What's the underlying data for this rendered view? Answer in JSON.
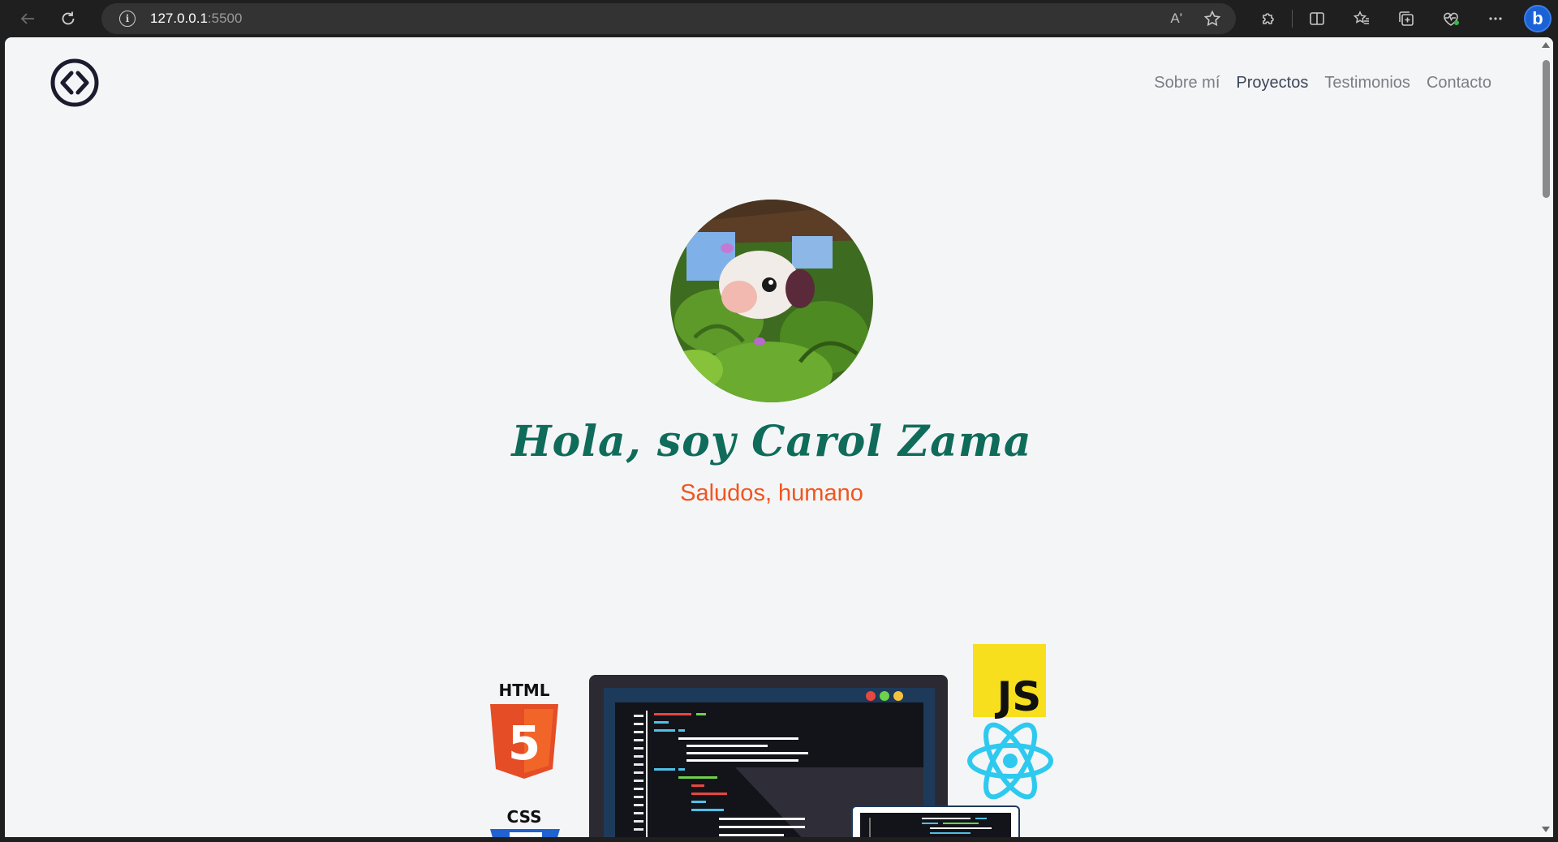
{
  "browser": {
    "url_host": "127.0.0.1",
    "url_port": ":5500",
    "read_aloud_label": "Aʹ"
  },
  "site": {
    "nav": [
      {
        "label": "Sobre mí",
        "active": false
      },
      {
        "label": "Proyectos",
        "active": true
      },
      {
        "label": "Testimonios",
        "active": false
      },
      {
        "label": "Contacto",
        "active": false
      }
    ],
    "hero": {
      "title": "Hola, soy Carol Zama",
      "subtitle": "Saludos, humano"
    },
    "tech_badges": {
      "html": "HTML",
      "css": "CSS",
      "js": "JS",
      "html_digit": "5"
    }
  },
  "colors": {
    "title": "#0f6b5a",
    "subtitle": "#f0561f",
    "page_bg": "#f4f5f7"
  }
}
